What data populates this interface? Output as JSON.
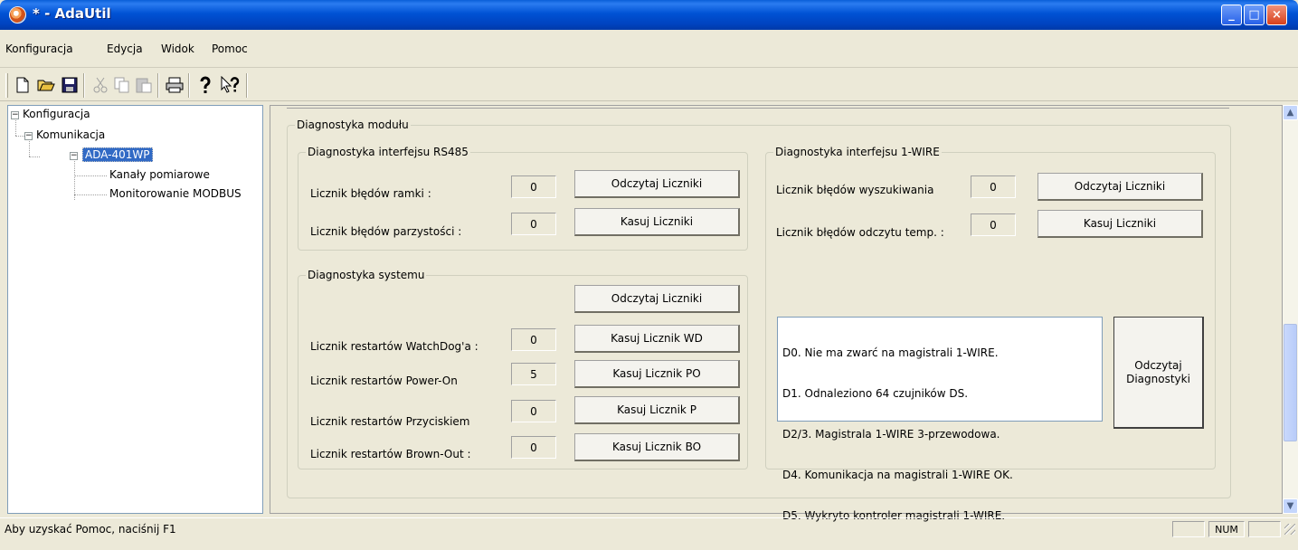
{
  "window": {
    "title": "* - AdaUtil",
    "controls": {
      "minimize": "_",
      "maximize": "□",
      "close": "×"
    }
  },
  "menu": [
    "Konfiguracja",
    "Edycja",
    "Widok",
    "Pomoc"
  ],
  "toolbar": {
    "icons": [
      "new-file-icon",
      "open-folder-icon",
      "save-icon",
      "cut-icon",
      "copy-icon",
      "paste-icon",
      "print-icon",
      "help-icon",
      "context-help-icon"
    ]
  },
  "tree": {
    "root": "Konfiguracja",
    "komunikacja": "Komunikacja",
    "device": "ADA-401WP",
    "children": [
      "Kanały pomiarowe",
      "Monitorowanie MODBUS"
    ]
  },
  "main": {
    "title": "Diagnostyka modułu",
    "rs485": {
      "title": "Diagnostyka interfejsu RS485",
      "rows": [
        {
          "label": "Licznik błędów ramki :",
          "value": "0",
          "button": "Odczytaj Liczniki"
        },
        {
          "label": "Licznik błędów parzystości :",
          "value": "0",
          "button": "Kasuj Liczniki"
        }
      ]
    },
    "system": {
      "title": "Diagnostyka systemu",
      "read_button": "Odczytaj Liczniki",
      "rows": [
        {
          "label": "Licznik restartów WatchDog'a :",
          "value": "0",
          "button": "Kasuj Licznik WD"
        },
        {
          "label": "Licznik restartów Power-On",
          "value": "5",
          "button": "Kasuj Licznik PO"
        },
        {
          "label": "Licznik restartów Przyciskiem",
          "value": "0",
          "button": "Kasuj Licznik P"
        },
        {
          "label": "Licznik restartów Brown-Out :",
          "value": "0",
          "button": "Kasuj Licznik BO"
        }
      ]
    },
    "onewire": {
      "title": "Diagnostyka interfejsu 1-WIRE",
      "rows": [
        {
          "label": "Licznik błędów wyszukiwania",
          "value": "0",
          "button": "Odczytaj Liczniki"
        },
        {
          "label": "Licznik błędów odczytu temp. :",
          "value": "0",
          "button": "Kasuj Liczniki"
        }
      ],
      "diagnostics": [
        "D0. Nie ma zwarć na magistrali 1-WIRE.",
        "D1. Odnaleziono 64 czujników DS.",
        "D2/3. Magistrala 1-WIRE 3-przewodowa.",
        "D4. Komunikacja na magistrali 1-WIRE OK.",
        "D5. Wykryto kontroler magistrali 1-WIRE."
      ],
      "diag_button_line1": "Odczytaj",
      "diag_button_line2": "Diagnostyki"
    }
  },
  "status": {
    "text": "Aby uzyskać Pomoc, naciśnij F1",
    "num": "NUM"
  }
}
